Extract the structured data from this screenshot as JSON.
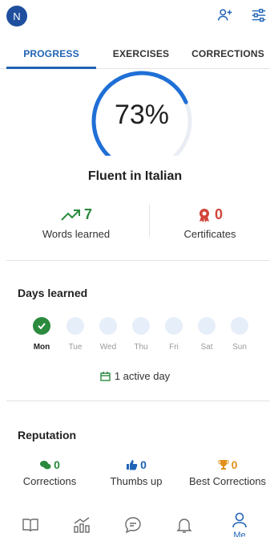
{
  "header": {
    "avatar_initial": "N"
  },
  "tabs": [
    {
      "label": "PROGRESS",
      "active": true
    },
    {
      "label": "EXERCISES",
      "active": false
    },
    {
      "label": "CORRECTIONS",
      "active": false
    }
  ],
  "progress": {
    "percent_value": 73,
    "percent_text": "73%",
    "level_title": "Fluent in Italian"
  },
  "stats": {
    "words": {
      "value": "7",
      "label": "Words learned"
    },
    "certificates": {
      "value": "0",
      "label": "Certificates"
    }
  },
  "days_learned": {
    "title": "Days learned",
    "days": [
      {
        "label": "Mon",
        "done": true
      },
      {
        "label": "Tue",
        "done": false
      },
      {
        "label": "Wed",
        "done": false
      },
      {
        "label": "Thu",
        "done": false
      },
      {
        "label": "Fri",
        "done": false
      },
      {
        "label": "Sat",
        "done": false
      },
      {
        "label": "Sun",
        "done": false
      }
    ],
    "active_text": "1 active day"
  },
  "reputation": {
    "title": "Reputation",
    "corrections": {
      "value": "0",
      "label": "Corrections"
    },
    "thumbs_up": {
      "value": "0",
      "label": "Thumbs up"
    },
    "best_corrections": {
      "value": "0",
      "label": "Best Corrections"
    }
  },
  "bottom_nav": {
    "me_label": "Me"
  },
  "colors": {
    "accent": "#1f63b5",
    "green": "#2b8a3e",
    "red": "#d2453a",
    "gold": "#e0901b"
  }
}
